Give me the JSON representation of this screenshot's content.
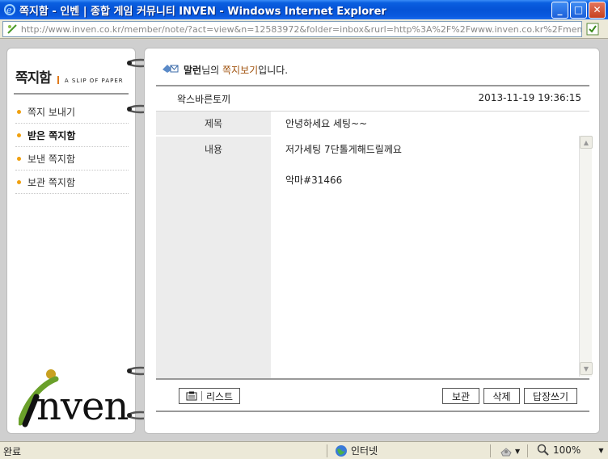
{
  "window": {
    "title": "쪽지함 - 인벤 | 종합 게임 커뮤니티 INVEN - Windows Internet Explorer",
    "minimize": "_",
    "maximize": "□",
    "close": "✕"
  },
  "address": {
    "url": "http://www.inven.co.kr/member/note/?act=view&n=12583972&folder=inbox&rurl=http%3A%2F%2Fwww.inven.co.kr%2Fmem"
  },
  "sidebar": {
    "logo_kr": "쪽지함",
    "logo_en": "A SLIP OF PAPER",
    "items": [
      {
        "label": "쪽지 보내기"
      },
      {
        "label": "받은 쪽지함"
      },
      {
        "label": "보낸 쪽지함"
      },
      {
        "label": "보관 쪽지함"
      }
    ],
    "brand": "nven"
  },
  "note": {
    "user": "말런",
    "greet_mid": "님의 ",
    "greet_link": "쪽지보기",
    "greet_end": "입니다.",
    "sender": "왁스바른토끼",
    "date": "2013-11-19 19:36:15",
    "subject_label": "제목",
    "subject": "안녕하세요 세팅~~",
    "body_label": "내용",
    "body_line1": "저가세팅 7단톨게해드릴께요",
    "body_line2": "악마#31466"
  },
  "buttons": {
    "list": "리스트",
    "keep": "보관",
    "delete": "삭제",
    "reply": "답장쓰기"
  },
  "status": {
    "text": "완료",
    "zone": "인터넷",
    "zoom": "100%"
  },
  "colors": {
    "titlebar": "#0553d6",
    "accent": "#a0520d",
    "bullet": "#f0a010"
  }
}
